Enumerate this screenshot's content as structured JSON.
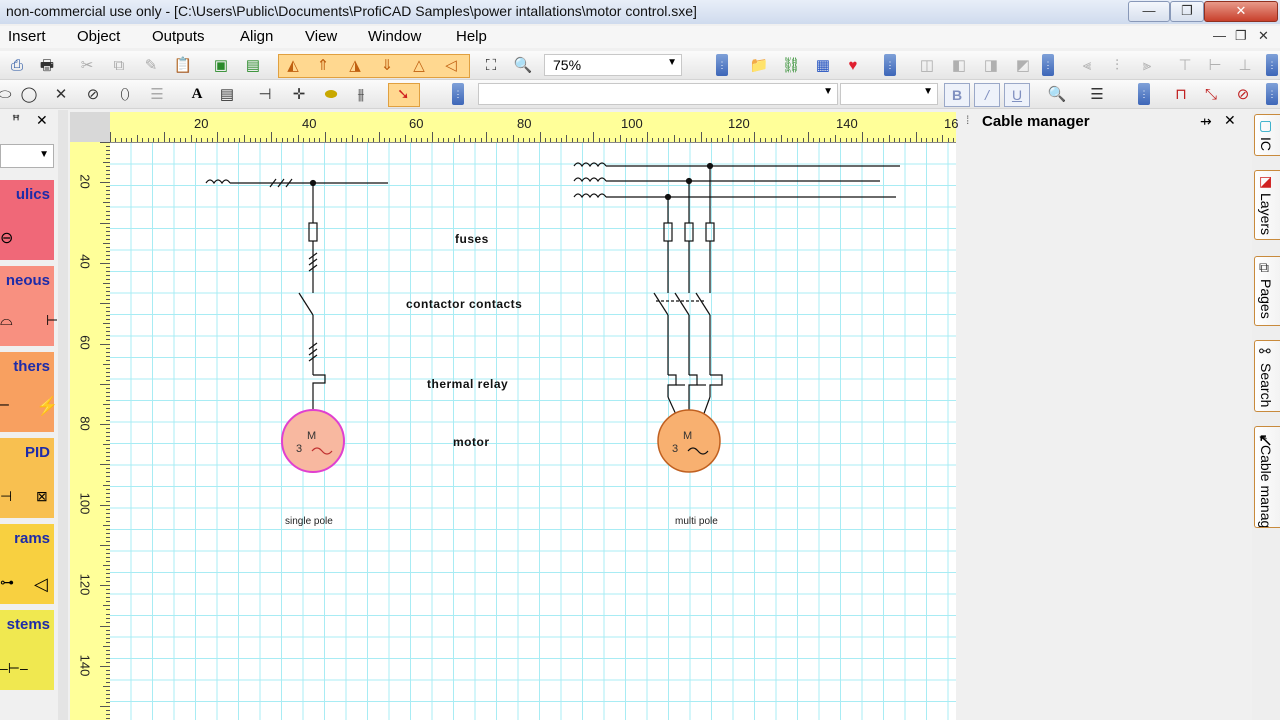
{
  "window": {
    "title": "non-commercial use only - [C:\\Users\\Public\\Documents\\ProfiCAD Samples\\power intallations\\motor control.sxe]"
  },
  "menu": [
    "Insert",
    "Object",
    "Outputs",
    "Align",
    "View",
    "Window",
    "Help"
  ],
  "toolbar": {
    "zoom_value": "75%",
    "font_bold": "B",
    "font_italic": "/",
    "font_underline": "U"
  },
  "left_panel": {
    "pin_glyph": "ꟸ",
    "close_glyph": "✕",
    "categories": [
      "ulics",
      "neous",
      "thers",
      "PID",
      "rams",
      "stems"
    ]
  },
  "ruler": {
    "top": [
      "20",
      "40",
      "60",
      "80",
      "100",
      "120",
      "140",
      "16"
    ],
    "left": [
      "20",
      "40",
      "60",
      "80",
      "100",
      "120",
      "140"
    ]
  },
  "drawing": {
    "label_fuses": "fuses",
    "label_contactor": "contactor contacts",
    "label_thermal": "thermal relay",
    "label_motor": "motor",
    "motor_letter": "M",
    "motor_phase": "3",
    "caption_single": "single pole",
    "caption_multi": "multi pole"
  },
  "cable_manager": {
    "title": "Cable manager"
  },
  "right_tabs": [
    "IC",
    "Layers",
    "Pages",
    "Search",
    "Cable manager"
  ],
  "colors": {
    "ruler": "#ffff99",
    "grid": "#a8ecf4",
    "motor_single_fill": "#f8b8a0",
    "motor_single_stroke": "#e040d0",
    "motor_multi_fill": "#f8b070",
    "cat_hydraulics": "#f06878",
    "cat_misc": "#f89080",
    "cat_others": "#f8a060",
    "cat_pid": "#f8c050",
    "cat_diagrams": "#f8d040",
    "cat_systems": "#f0e850"
  }
}
